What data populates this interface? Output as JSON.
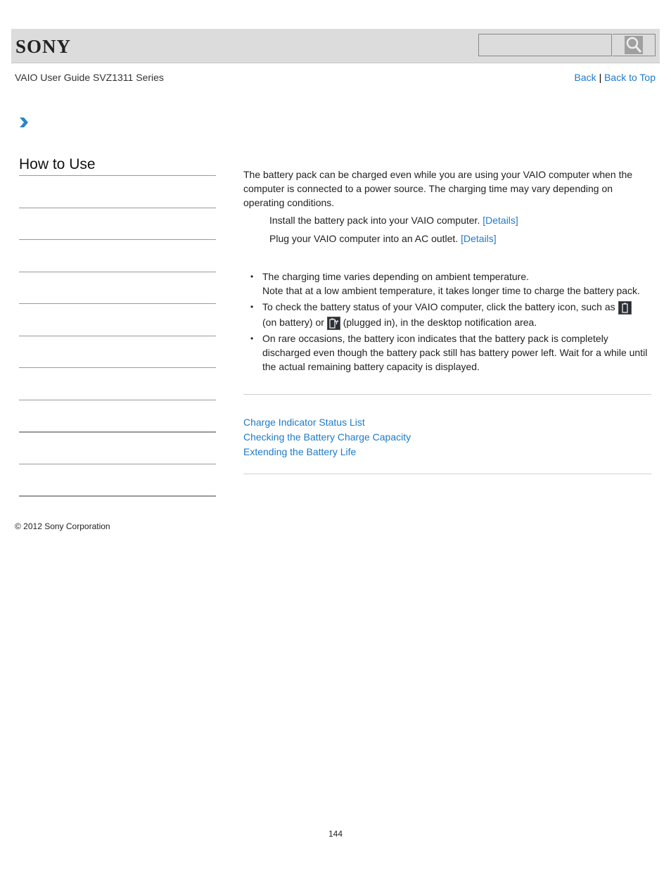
{
  "header": {
    "logo": "SONY",
    "search": {
      "placeholder": "",
      "value": "",
      "button_icon": "search-icon"
    }
  },
  "guide_title": "VAIO User Guide SVZ1311 Series",
  "topnav": {
    "back": "Back",
    "separator": "|",
    "back_to_top": "Back to Top"
  },
  "breadcrumb_icon": "chevron-right-icon",
  "sidebar": {
    "title": "How to Use",
    "item_count": 10
  },
  "main": {
    "intro": "The battery pack can be charged even while you are using your VAIO computer when the computer is connected to a power source. The charging time may vary depending on operating conditions.",
    "steps": [
      {
        "text": "Install the battery pack into your VAIO computer. ",
        "link": "[Details]"
      },
      {
        "text": "Plug your VAIO computer into an AC outlet. ",
        "link": "[Details]"
      }
    ],
    "notes": {
      "n1_line1": "The charging time varies depending on ambient temperature.",
      "n1_line2": "Note that at a low ambient temperature, it takes longer time to charge the battery pack.",
      "n2_a": "To check the battery status of your VAIO computer, click the battery icon, such as ",
      "n2_b": "(on battery) or ",
      "n2_c": " (plugged in), in the desktop notification area.",
      "n3": "On rare occasions, the battery icon indicates that the battery pack is completely discharged even though the battery pack still has battery power left. Wait for a while until the actual remaining battery capacity is displayed."
    }
  },
  "related_links": [
    "Charge Indicator Status List",
    "Checking the Battery Charge Capacity",
    "Extending the Battery Life"
  ],
  "footer": {
    "copyright": "© 2012 Sony Corporation",
    "page_number": "144"
  }
}
